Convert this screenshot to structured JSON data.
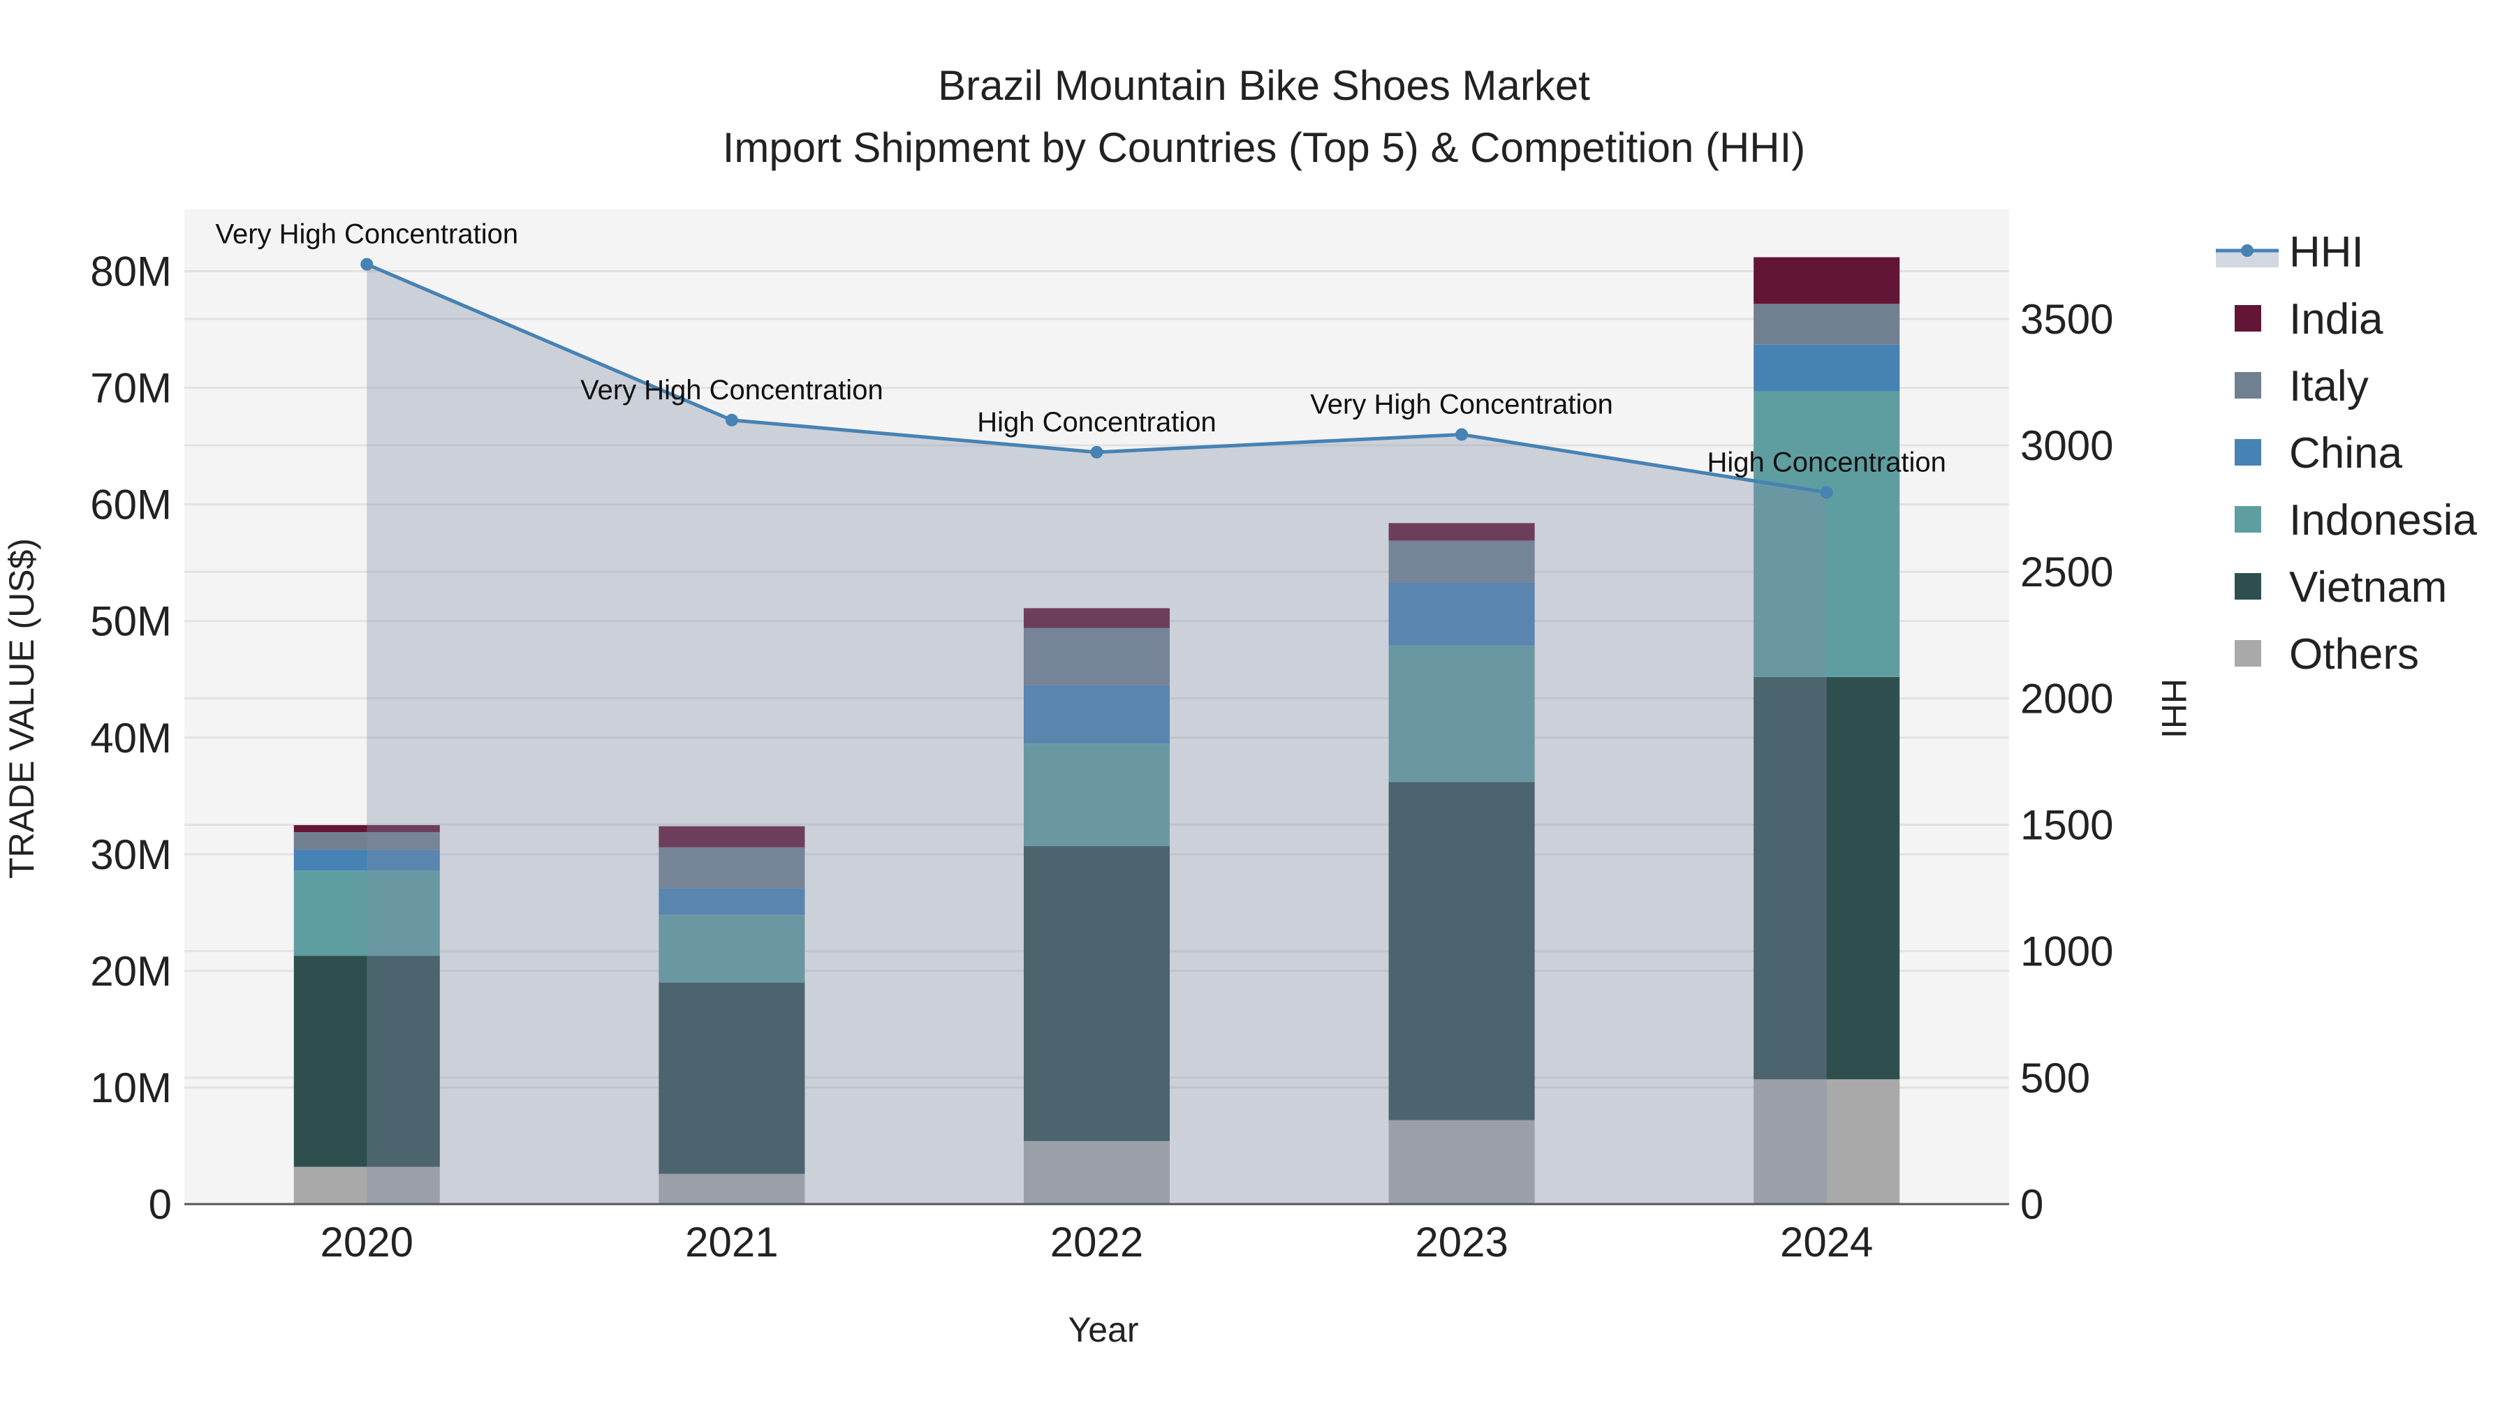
{
  "chart_data": {
    "type": "bar",
    "title": "Brazil Mountain Bike Shoes Market",
    "subtitle": "Import Shipment by Countries (Top 5) & Competition (HHI)",
    "xlabel": "Year",
    "ylabel": "TRADE VALUE (US$)",
    "y2label": "HHI",
    "categories": [
      "2020",
      "2021",
      "2022",
      "2023",
      "2024"
    ],
    "ylim": [
      0,
      85.3
    ],
    "y_unit": "M",
    "yticks": [
      0,
      10,
      20,
      30,
      40,
      50,
      60,
      70,
      80
    ],
    "ytick_labels": [
      "0",
      "10M",
      "20M",
      "30M",
      "40M",
      "50M",
      "60M",
      "70M",
      "80M"
    ],
    "y2lim": [
      0,
      3933
    ],
    "y2ticks": [
      0,
      500,
      1000,
      1500,
      2000,
      2500,
      3000,
      3500
    ],
    "y2tick_labels": [
      "0",
      "500",
      "1000",
      "1500",
      "2000",
      "2500",
      "3000",
      "3500"
    ],
    "grid": true,
    "legend_position": "right",
    "series": [
      {
        "name": "Others",
        "color": "#a9a9a9",
        "values": [
          3.2,
          2.6,
          5.4,
          7.2,
          10.7
        ]
      },
      {
        "name": "Vietnam",
        "color": "#2f4f4f",
        "values": [
          18.1,
          16.4,
          25.3,
          29.0,
          34.5
        ]
      },
      {
        "name": "Indonesia",
        "color": "#5f9ea0",
        "values": [
          7.3,
          5.8,
          8.8,
          11.7,
          24.5
        ]
      },
      {
        "name": "China",
        "color": "#4682b4",
        "values": [
          1.8,
          2.3,
          5.0,
          5.4,
          4.0
        ]
      },
      {
        "name": "Italy",
        "color": "#708090",
        "values": [
          1.5,
          3.5,
          4.9,
          3.6,
          3.5
        ]
      },
      {
        "name": "India",
        "color": "#631535",
        "values": [
          0.6,
          1.8,
          1.7,
          1.5,
          4.0
        ]
      }
    ],
    "hhi": {
      "name": "HHI",
      "color": "#4682b4",
      "values": [
        3716,
        3100,
        2973,
        3043,
        2814
      ],
      "annotations": [
        "Very High Concentration",
        "Very High Concentration",
        "High Concentration",
        "Very High Concentration",
        "High Concentration"
      ]
    },
    "legend_order": [
      "HHI",
      "India",
      "Italy",
      "China",
      "Indonesia",
      "Vietnam",
      "Others"
    ]
  }
}
